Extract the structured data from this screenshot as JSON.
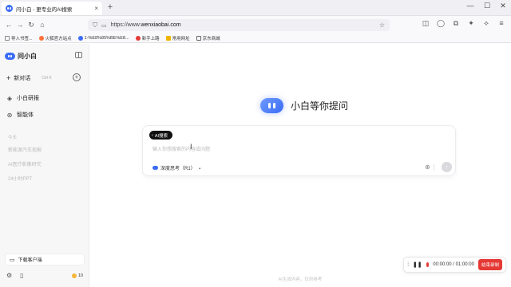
{
  "browser": {
    "tab_title": "问小白 - 更专业的AI搜索",
    "tab_close": "×",
    "new_tab": "+",
    "url_prefix": "https://www.",
    "url_domain": "wenxiaobai.com",
    "window_controls": [
      "—",
      "☐",
      "✕"
    ]
  },
  "bookmarks": [
    {
      "label": "导入书签...",
      "color": "#888888"
    },
    {
      "label": "火狐官方站点",
      "color": "#ff7139"
    },
    {
      "label": "1-%E8%85%BE%E8...",
      "color": "#3b6cf6"
    },
    {
      "label": "新手上路",
      "color": "#e53935"
    },
    {
      "label": "常用网址",
      "color": "#f0b400"
    },
    {
      "label": "京东商城",
      "color": "#666666"
    }
  ],
  "sidebar": {
    "brand": "问小白",
    "new_chat": "新对话",
    "new_chat_shortcut": "Ctrl K",
    "nav": [
      {
        "label": "小白研报",
        "icon": "research-icon"
      },
      {
        "label": "智能体",
        "icon": "agent-icon"
      }
    ],
    "history_header": "今天",
    "history": [
      "新能源汽车现报",
      "AI医疗影像研究",
      "24小时PPT"
    ],
    "download": "下载客户端",
    "coins": "10"
  },
  "main": {
    "hero_text": "小白等你提问",
    "chip": "AI搜索",
    "placeholder": "输入你想搜索的内容或问题",
    "mode": "深度思考（R1）",
    "disclaimer": "AI生成内容，仅供参考"
  },
  "recorder": {
    "time": "00:00:00 / 01:00:00",
    "end_label": "结束录制"
  },
  "colors": {
    "accent": "#3b6cf6",
    "record_red": "#e53935"
  }
}
